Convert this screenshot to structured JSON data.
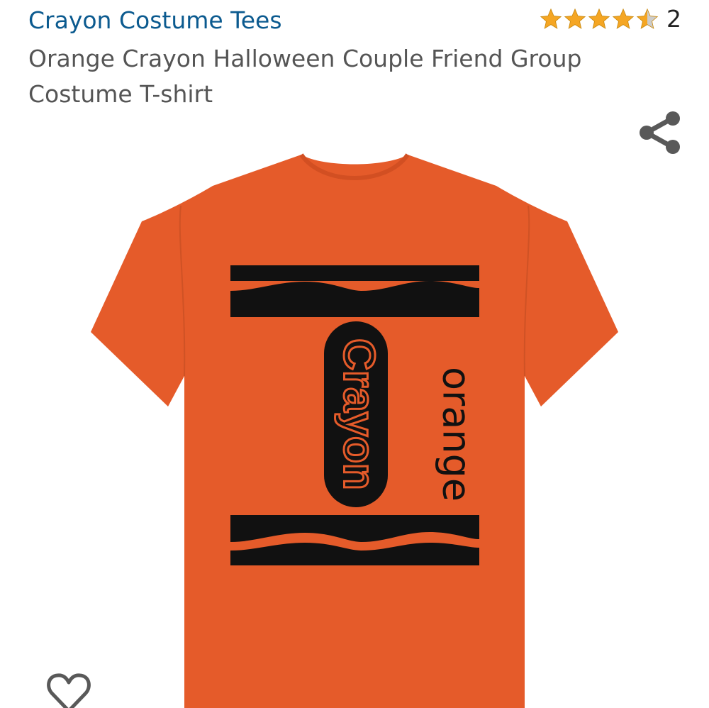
{
  "listing": {
    "brand": "Crayon Costume Tees",
    "title": "Orange Crayon Halloween Couple Friend Group Costume T-shirt",
    "rating": {
      "stars": 4.5,
      "count": "2"
    }
  },
  "shirt": {
    "logo_text": "Crayon",
    "color_name": "orange"
  },
  "colors": {
    "brand_link": "#0b5a8f",
    "title_text": "#555555",
    "star_fill": "#f5a623",
    "star_empty": "#cccccc",
    "icon": "#595959",
    "shirt": "#e55b2a",
    "print": "#111111"
  },
  "icons": {
    "share": "share-icon",
    "wishlist": "heart-outline-icon",
    "rating": "star-icon"
  }
}
